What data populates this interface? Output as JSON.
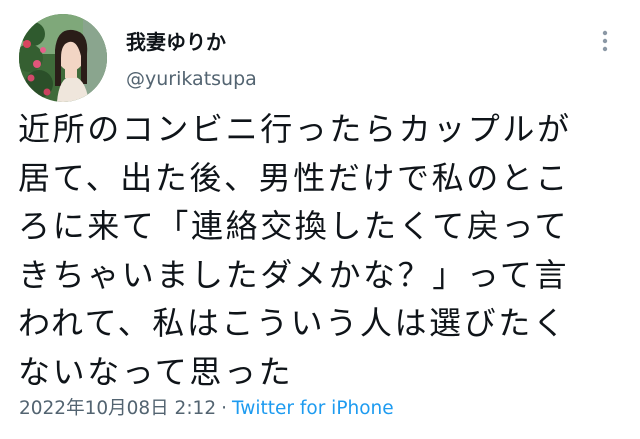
{
  "tweet": {
    "author": {
      "display_name": "我妻ゆりか",
      "handle": "@yurikatsupa"
    },
    "more_icon": "vertical-ellipsis-icon",
    "text_lines": [
      "近所のコンビニ行ったらカップルが",
      "居て、出た後、男性だけで私のとこ",
      "ろに来て「連絡交換したくて戻って",
      "きちゃいましたダメかな？」って言",
      "われて、私はこういう人は選びたく",
      "ないなって思った"
    ],
    "timestamp": "2022年10月08日 2:12",
    "separator": "·",
    "source": "Twitter for iPhone"
  },
  "colors": {
    "text": "#0f1419",
    "secondary": "#536471",
    "link": "#1d9bf0",
    "background": "#ffffff"
  }
}
